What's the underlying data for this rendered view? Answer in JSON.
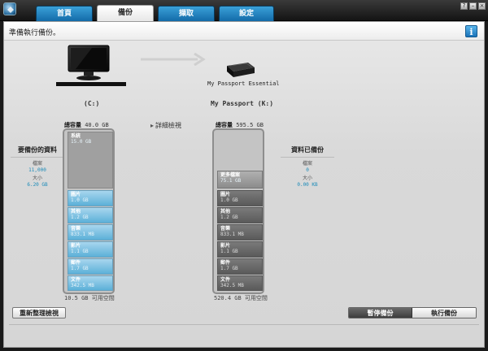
{
  "tabs": [
    {
      "label": "首頁",
      "active": false
    },
    {
      "label": "備份",
      "active": true
    },
    {
      "label": "擷取",
      "active": false
    },
    {
      "label": "設定",
      "active": false
    }
  ],
  "window_controls": {
    "help": "?",
    "minimize": "–",
    "close": "×"
  },
  "status": {
    "text": "準備執行備份。",
    "info_icon": "i"
  },
  "devices": {
    "drive_name": "My Passport Essential",
    "left_volume": "(C:)",
    "right_volume": "My Passport (K:)"
  },
  "detail_link": "詳細檢視",
  "left_column": {
    "capacity_label": "總容量",
    "capacity_value": "40.0 GB",
    "free": "10.5 GB 可用空間",
    "segments": [
      {
        "name": "系統",
        "size": "15.0 GB"
      },
      {
        "name": "圖片",
        "size": "1.0 GB"
      },
      {
        "name": "其他",
        "size": "1.2 GB"
      },
      {
        "name": "音樂",
        "size": "833.1 MB"
      },
      {
        "name": "影片",
        "size": "1.1 GB"
      },
      {
        "name": "郵件",
        "size": "1.7 GB"
      },
      {
        "name": "文件",
        "size": "342.5 MB"
      }
    ]
  },
  "right_column": {
    "capacity_label": "總容量",
    "capacity_value": "595.5 GB",
    "free": "520.4 GB 可用空間",
    "segments": [
      {
        "name": "更多檔案",
        "size": "75.1 GB"
      },
      {
        "name": "圖片",
        "size": "1.0 GB"
      },
      {
        "name": "其他",
        "size": "1.2 GB"
      },
      {
        "name": "音樂",
        "size": "833.1 MB"
      },
      {
        "name": "影片",
        "size": "1.1 GB"
      },
      {
        "name": "郵件",
        "size": "1.7 GB"
      },
      {
        "name": "文件",
        "size": "342.5 MB"
      }
    ]
  },
  "left_info": {
    "heading": "要備份的資料",
    "count_label": "檔案",
    "count_value": "11,000",
    "size_label": "大小",
    "size_value": "6.20 GB"
  },
  "right_info": {
    "heading": "資料已備份",
    "count_label": "檔案",
    "count_value": "0",
    "size_label": "大小",
    "size_value": "0.00 KB"
  },
  "buttons": {
    "rescan": "重新整理檢視",
    "pause": "暫停備份",
    "run": "執行備份"
  }
}
